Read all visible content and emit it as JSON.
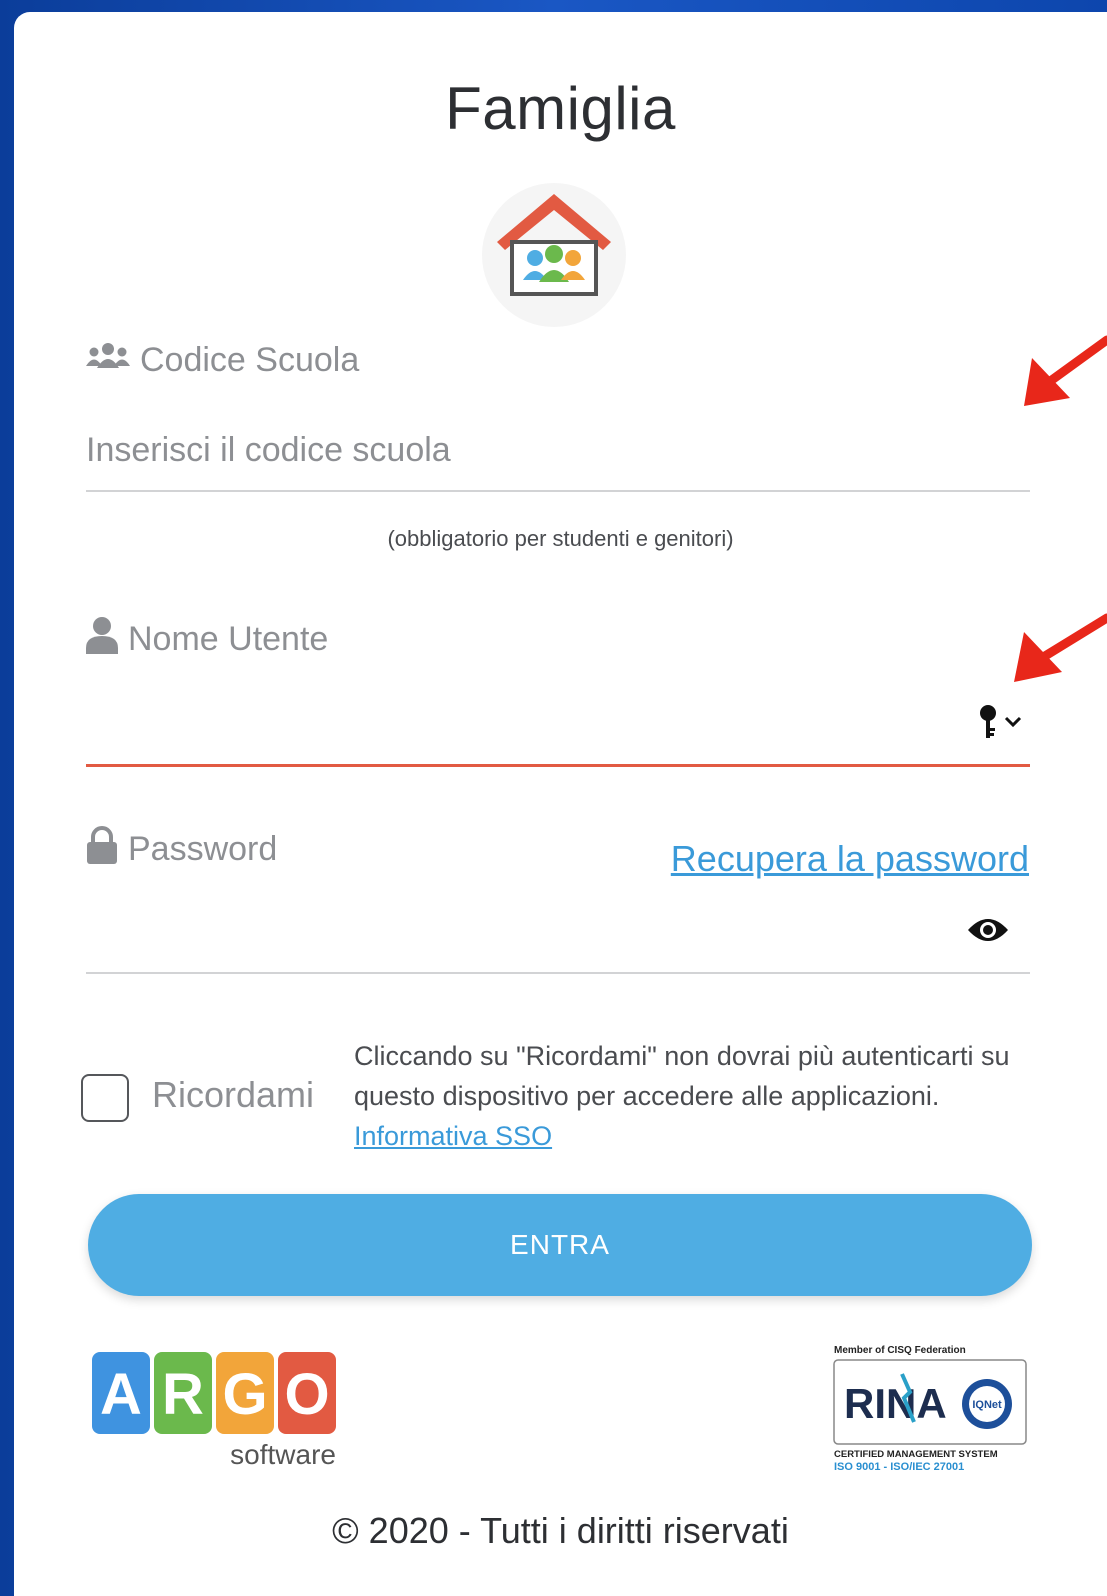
{
  "header": {
    "title": "Famiglia"
  },
  "school_code": {
    "label": "Codice Scuola",
    "placeholder": "Inserisci il codice scuola",
    "value": "",
    "hint": "(obbligatorio per studenti e genitori)"
  },
  "username": {
    "label": "Nome Utente",
    "value": ""
  },
  "password": {
    "label": "Password",
    "recover_link": "Recupera la password",
    "value": ""
  },
  "remember": {
    "label": "Ricordami",
    "checked": false,
    "description": "Cliccando su \"Ricordami\" non dovrai più autenticarti su questo dispositivo per accedere alle applicazioni.",
    "sso_link": "Informativa SSO"
  },
  "submit": {
    "label": "ENTRA"
  },
  "footer": {
    "argo_letters": [
      "A",
      "R",
      "G",
      "O"
    ],
    "argo_sub": "software",
    "rina_member": "Member of CISQ Federation",
    "rina_name": "RINA",
    "rina_iqnet": "IQNet",
    "rina_cert": "CERTIFIED MANAGEMENT SYSTEM",
    "rina_iso": "ISO 9001 - ISO/IEC 27001",
    "copyright": "© 2020 - Tutti i diritti riservati"
  },
  "icons": {
    "school": "users-icon",
    "user": "user-icon",
    "lock": "lock-icon",
    "key": "key-icon",
    "eye": "eye-icon",
    "logo": "family-home-logo-icon",
    "annotation": "red-arrow-icon"
  },
  "colors": {
    "accent_button": "#4fade3",
    "link": "#3a9ad9",
    "active_underline": "#e25a42",
    "background": "#1a57c4",
    "annotation": "#e8271a"
  }
}
